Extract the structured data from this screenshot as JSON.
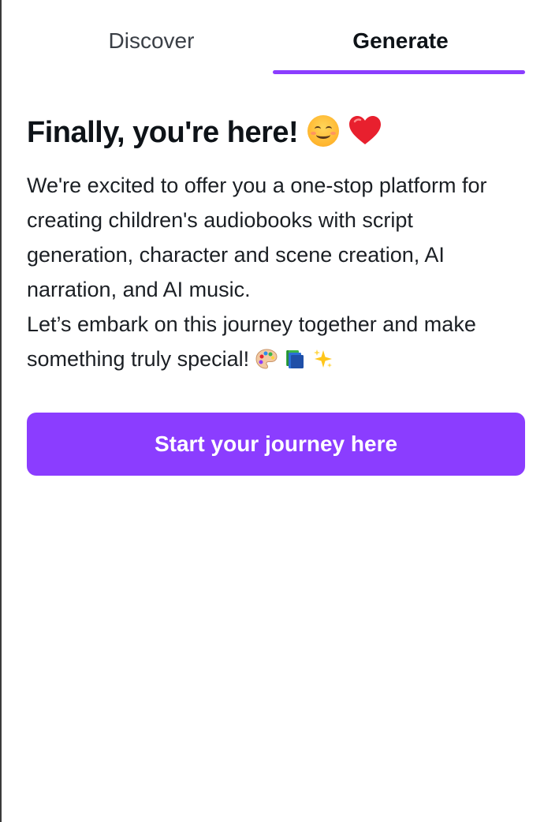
{
  "tabs": {
    "discover_label": "Discover",
    "generate_label": "Generate",
    "active": "Generate"
  },
  "colors": {
    "accent": "#8b3dff",
    "text_primary": "#0e1318",
    "text_secondary": "#3a3f46",
    "heart": "#e8202e"
  },
  "intro": {
    "heading": "Finally, you're here!",
    "heading_icons": [
      "smiling-face-icon",
      "red-heart-icon"
    ],
    "paragraph_1": "We're excited to offer you a one-stop platform for creating children's audiobooks with script generation, character and scene creation, AI narration, and AI music.",
    "paragraph_2": "Let’s embark on this journey together and make something truly special!",
    "paragraph_2_icons": [
      "artist-palette-icon",
      "books-icon",
      "sparkles-icon"
    ]
  },
  "cta": {
    "label": "Start your journey here"
  }
}
